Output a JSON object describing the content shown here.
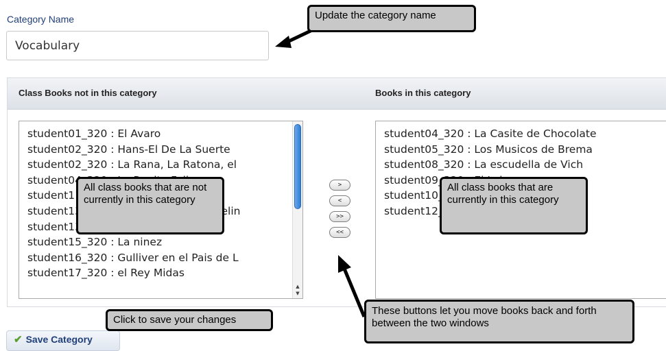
{
  "category": {
    "label": "Category Name",
    "value": "Vocabulary"
  },
  "left_list": {
    "title": "Class Books not in this category",
    "items": [
      "student01_320 : El Avaro",
      "student02_320 : Hans-El De La Suerte",
      "student02_320 : La Rana, La Ratona, el",
      "student04_320 : La Ranita Feliz",
      "student11_320 : Los Tres Ratones",
      "student13_320 : El Flautista de Hamelin",
      "student13_320 : Pulgarcita",
      "student15_320 : La ninez",
      "student16_320 : Gulliver en el Pais de L",
      "student17_320 : el Rey Midas"
    ]
  },
  "right_list": {
    "title": "Books in this category",
    "items": [
      "student04_320 : La Casite de Chocolate",
      "student05_320 : Los Musicos de Brema",
      "student08_320 : La escudella de Vich",
      "student09_320 : El Lobo",
      "student10_320 : Los Huev",
      "student12_320 : Botas"
    ]
  },
  "move_buttons": {
    "add_one": ">",
    "remove_one": "<",
    "add_all": ">>",
    "remove_all": "<<"
  },
  "callouts": {
    "update_name": "Update the category name",
    "not_in_category": "All class books that are not currently in this category",
    "in_category": "All class books that are currently in this category",
    "move_buttons": "These buttons let you move books back and forth between the two windows",
    "save": "Click to save your changes"
  },
  "save_button": {
    "label": "Save Category",
    "icon": "checkmark-icon"
  },
  "colors": {
    "label_blue": "#1f3f7a",
    "callout_fill": "#c8c8c8",
    "scroll_thumb": "#2f7ed8",
    "check_green": "#5a9e2f"
  }
}
